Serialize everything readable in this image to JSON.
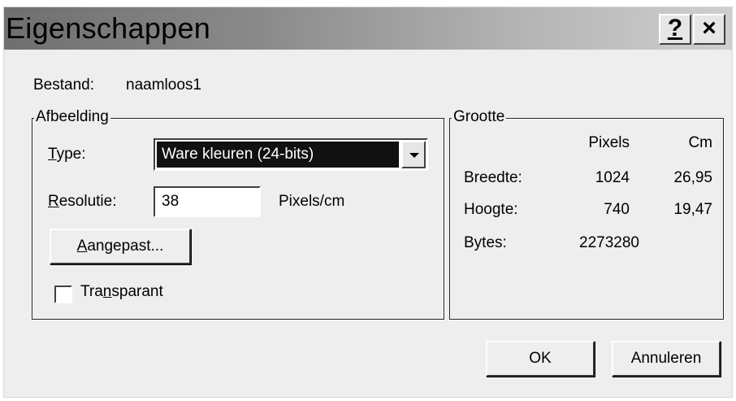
{
  "window": {
    "title": "Eigenschappen",
    "help_button": "?",
    "close_button": "×"
  },
  "file": {
    "label": "Bestand:",
    "name": "naamloos1"
  },
  "image_group": {
    "title": "Afbeelding",
    "type_label_first": "T",
    "type_label_rest": "ype:",
    "type_value": "Ware kleuren (24-bits)",
    "resolution_label_first": "R",
    "resolution_label_rest": "esolutie:",
    "resolution_value": "38",
    "resolution_unit": "Pixels/cm",
    "custom_button_first": "A",
    "custom_button_rest": "angepast...",
    "transparent_label_pre": "Tra",
    "transparent_label_u": "n",
    "transparent_label_post": "sparant",
    "transparent_checked": false
  },
  "size_group": {
    "title": "Grootte",
    "col_pixels": "Pixels",
    "col_cm": "Cm",
    "width_label": "Breedte:",
    "width_pixels": "1024",
    "width_cm": "26,95",
    "height_label": "Hoogte:",
    "height_pixels": "740",
    "height_cm": "19,47",
    "bytes_label": "Bytes:",
    "bytes_value": "2273280"
  },
  "buttons": {
    "ok": "OK",
    "cancel": "Annuleren"
  },
  "colors": {
    "dialog_bg": "#eeeeee",
    "selection_bg": "#111111",
    "titlebar_gradient_start": "#6f6f6f",
    "titlebar_gradient_end": "#cfcfcf"
  }
}
